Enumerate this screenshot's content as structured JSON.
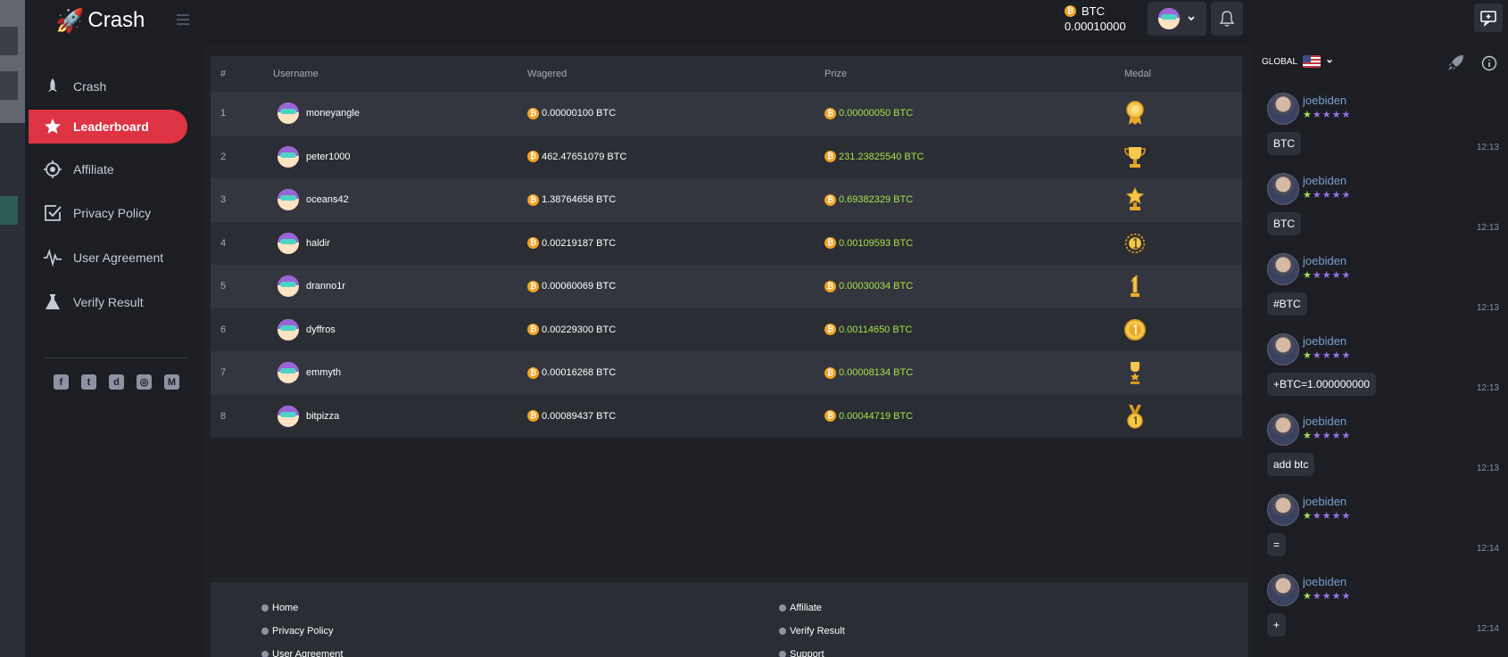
{
  "app": {
    "logo_text": "Crash"
  },
  "header": {
    "currency": "BTC",
    "balance": "0.00010000",
    "coin_symbol": "₿"
  },
  "sidebar": {
    "items": [
      {
        "label": "Crash",
        "icon": "rocket-icon",
        "active": false
      },
      {
        "label": "Leaderboard",
        "icon": "star-icon",
        "active": true
      },
      {
        "label": "Affiliate",
        "icon": "target-icon",
        "active": false
      },
      {
        "label": "Privacy Policy",
        "icon": "checkbox-icon",
        "active": false
      },
      {
        "label": "User Agreement",
        "icon": "pulse-icon",
        "active": false
      },
      {
        "label": "Verify Result",
        "icon": "flask-icon",
        "active": false
      }
    ],
    "socials": [
      "facebook-icon",
      "twitter-icon",
      "discord-icon",
      "dribbble-icon",
      "medium-icon"
    ]
  },
  "table": {
    "headers": {
      "rank": "#",
      "username": "Username",
      "wagered": "Wagered",
      "prize": "Prize",
      "medal": "Medal"
    },
    "rows": [
      {
        "rank": "1",
        "username": "moneyangle",
        "wagered": "0.00000100 BTC",
        "prize": "0.00000050 BTC",
        "medal": "rosette-medal-icon"
      },
      {
        "rank": "2",
        "username": "peter1000",
        "wagered": "462.47651079 BTC",
        "prize": "231.23825540 BTC",
        "medal": "trophy-cup-icon"
      },
      {
        "rank": "3",
        "username": "oceans42",
        "wagered": "1.38764658 BTC",
        "prize": "0.69382329 BTC",
        "medal": "star-trophy-icon"
      },
      {
        "rank": "4",
        "username": "haldir",
        "wagered": "0.00219187 BTC",
        "prize": "0.00109593 BTC",
        "medal": "laurel-medal-icon"
      },
      {
        "rank": "5",
        "username": "dranno1r",
        "wagered": "0.00060069 BTC",
        "prize": "0.00030034 BTC",
        "medal": "number-one-trophy-icon"
      },
      {
        "rank": "6",
        "username": "dyffros",
        "wagered": "0.00229300 BTC",
        "prize": "0.00114650 BTC",
        "medal": "gold-coin-medal-icon"
      },
      {
        "rank": "7",
        "username": "emmyth",
        "wagered": "0.00016268 BTC",
        "prize": "0.00008134 BTC",
        "medal": "small-trophy-icon"
      },
      {
        "rank": "8",
        "username": "bitpizza",
        "wagered": "0.00089437 BTC",
        "prize": "0.00044719 BTC",
        "medal": "ribbon-medal-icon"
      }
    ]
  },
  "footer": {
    "links": [
      "Home",
      "Affiliate",
      "Privacy Policy",
      "Verify Result",
      "User Agreement",
      "Support"
    ]
  },
  "chat": {
    "channel": "GLOBAL",
    "messages": [
      {
        "user": "joebiden",
        "text": "BTC",
        "time": "12:13"
      },
      {
        "user": "joebiden",
        "text": "BTC",
        "time": "12:13"
      },
      {
        "user": "joebiden",
        "text": "#BTC",
        "time": "12:13"
      },
      {
        "user": "joebiden",
        "text": "+BTC=1.000000000",
        "time": "12:13"
      },
      {
        "user": "joebiden",
        "text": "add btc",
        "time": "12:13"
      },
      {
        "user": "joebiden",
        "text": "=",
        "time": "12:14"
      },
      {
        "user": "joebiden",
        "text": "+",
        "time": "12:14"
      }
    ]
  },
  "colors": {
    "accent": "#dd3343",
    "prize": "#a7e04a",
    "username": "#7b9fd1",
    "coin": "#f3a221"
  }
}
